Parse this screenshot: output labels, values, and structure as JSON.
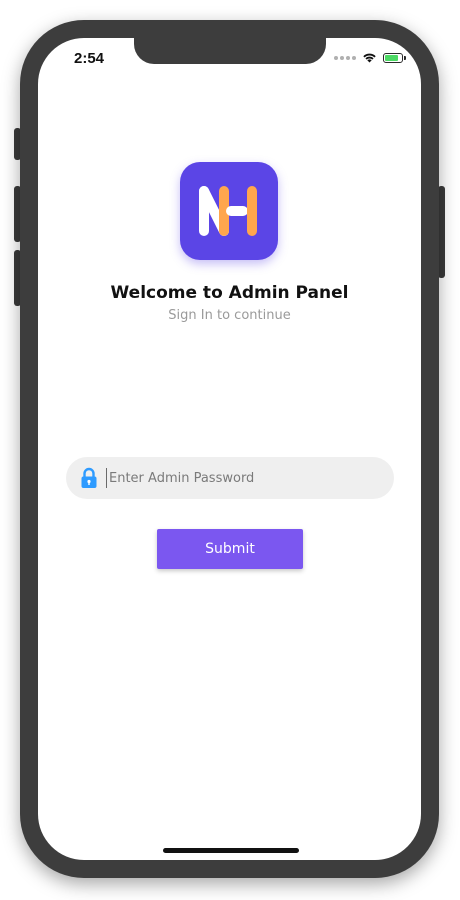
{
  "status_bar": {
    "time": "2:54",
    "battery_level": 0.8,
    "battery_color": "#4cd964"
  },
  "app": {
    "logo_text": "NH",
    "logo_bg": "#5b45e6",
    "logo_accent": "#ffa64d",
    "title": "Welcome to Admin Panel",
    "subtitle": "Sign In to continue"
  },
  "login": {
    "password_placeholder": "Enter Admin Password",
    "password_value": "",
    "lock_icon": "lock-icon",
    "lock_color": "#2e9bff",
    "submit_label": "Submit",
    "submit_color": "#7b57f0"
  }
}
